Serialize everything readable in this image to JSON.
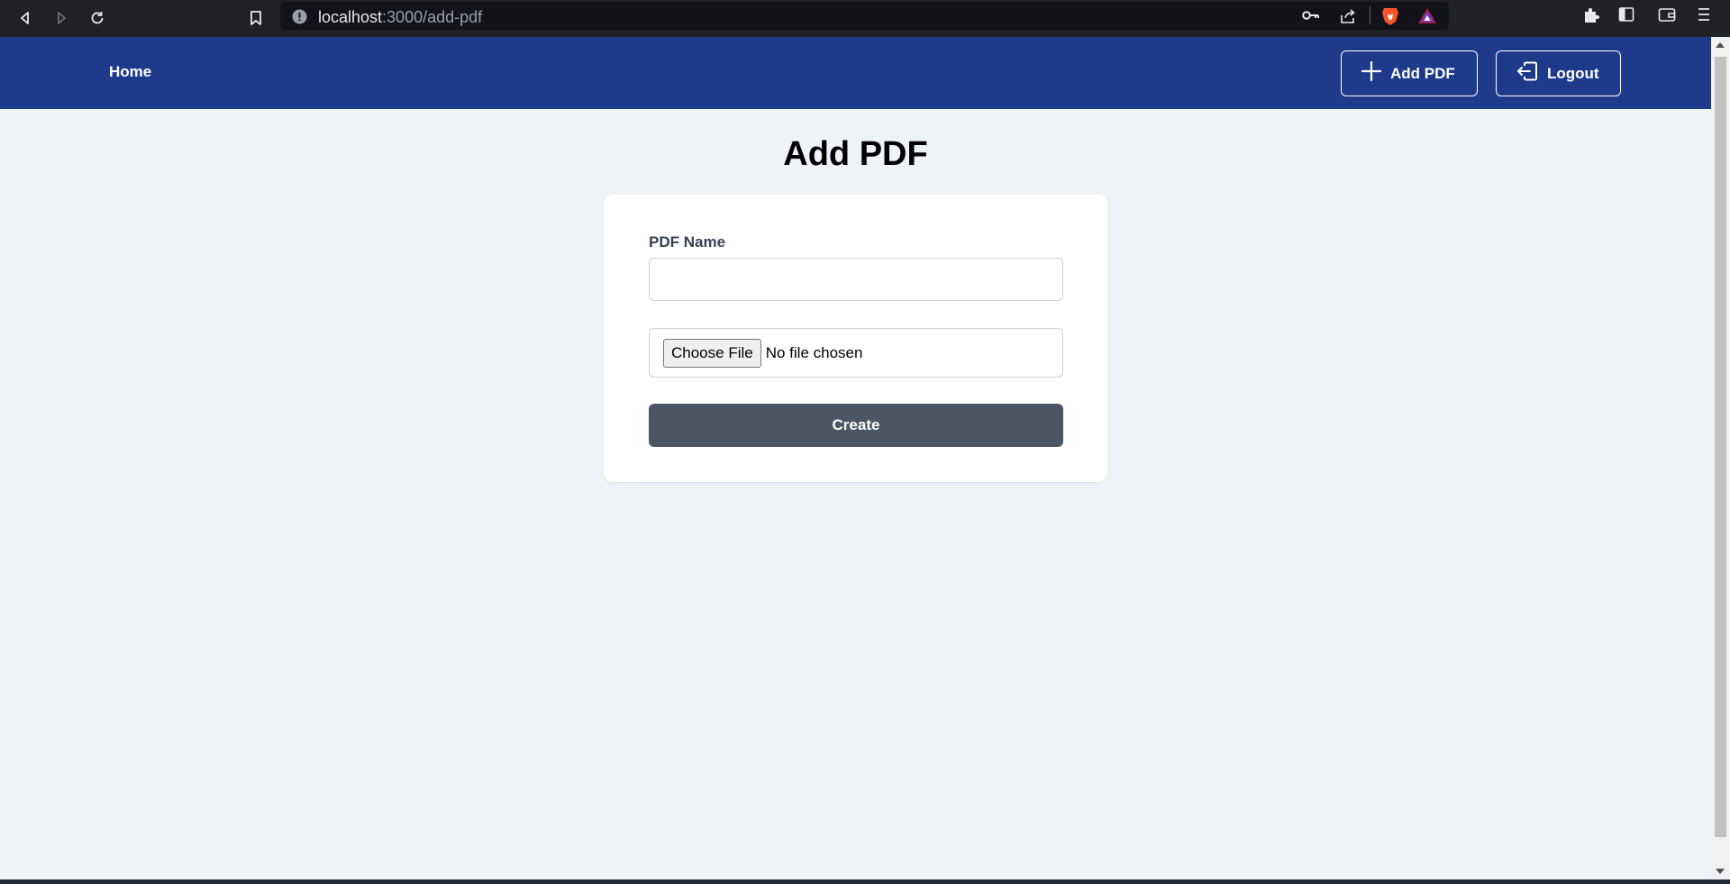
{
  "browser": {
    "url_host": "localhost",
    "url_path": ":3000/add-pdf",
    "icons": [
      "back-icon",
      "forward-icon",
      "reload-icon",
      "bookmark-icon",
      "info-icon",
      "key-icon",
      "share-icon",
      "brave-shield-icon",
      "brave-rewards-icon",
      "extensions-icon",
      "sidebar-icon",
      "wallet-icon",
      "menu-icon"
    ]
  },
  "nav": {
    "home": "Home",
    "add_pdf": "Add PDF",
    "logout": "Logout",
    "background_color": "#1e3a8a"
  },
  "page": {
    "title": "Add PDF"
  },
  "form": {
    "name_label": "PDF Name",
    "name_value": "",
    "file_button": "Choose File",
    "file_status": "No file chosen",
    "submit": "Create",
    "submit_color": "#4b5563"
  }
}
